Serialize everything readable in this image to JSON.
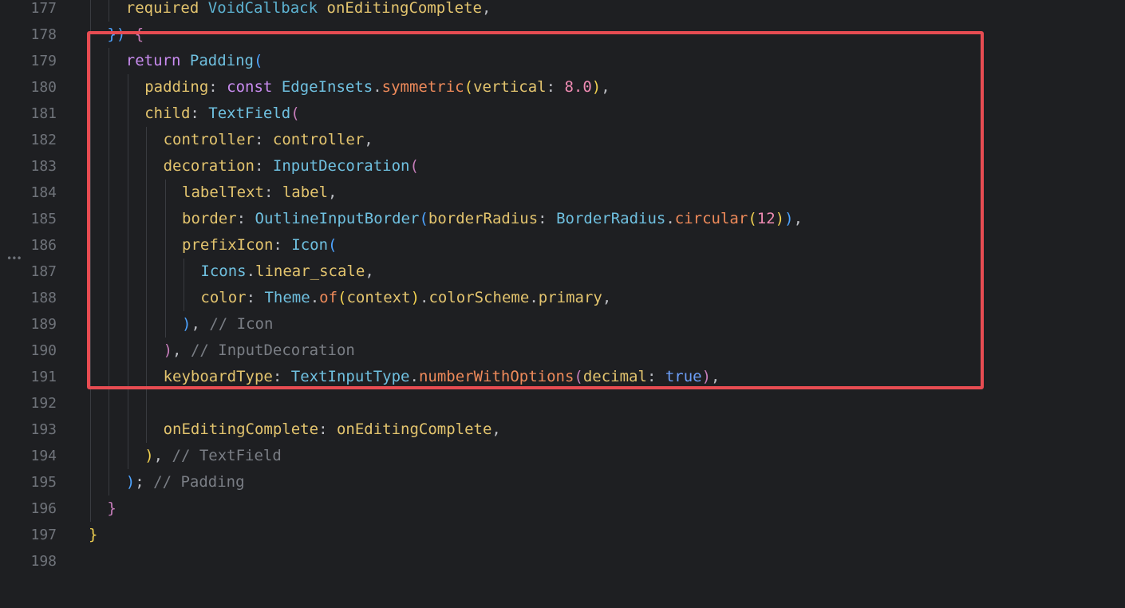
{
  "editor": {
    "lines": [
      {
        "n": "177",
        "tokens": [
          [
            "prop",
            "required"
          ],
          [
            "plain",
            " "
          ],
          [
            "cls",
            "VoidCallback"
          ],
          [
            "plain",
            " "
          ],
          [
            "prop",
            "onEditingComplete"
          ],
          [
            "plain",
            ","
          ]
        ],
        "indent": 2
      },
      {
        "n": "178",
        "tokens": [
          [
            "par3",
            "})"
          ],
          [
            "plain",
            " "
          ],
          [
            "par1",
            "{"
          ]
        ],
        "indent": 1
      },
      {
        "n": "179",
        "tokens": [
          [
            "retkw",
            "return"
          ],
          [
            "plain",
            " "
          ],
          [
            "clsb",
            "Padding"
          ],
          [
            "par3",
            "("
          ]
        ],
        "indent": 2
      },
      {
        "n": "180",
        "tokens": [
          [
            "prop",
            "padding"
          ],
          [
            "plain",
            ": "
          ],
          [
            "constkw",
            "const"
          ],
          [
            "plain",
            " "
          ],
          [
            "clsb",
            "EdgeInsets"
          ],
          [
            "plain",
            "."
          ],
          [
            "fn",
            "symmetric"
          ],
          [
            "par2",
            "("
          ],
          [
            "prop",
            "vertical"
          ],
          [
            "plain",
            ": "
          ],
          [
            "num",
            "8.0"
          ],
          [
            "par2",
            ")"
          ],
          [
            "plain",
            ","
          ]
        ],
        "indent": 3
      },
      {
        "n": "181",
        "tokens": [
          [
            "prop",
            "child"
          ],
          [
            "plain",
            ": "
          ],
          [
            "clsb",
            "TextField"
          ],
          [
            "par1",
            "("
          ]
        ],
        "indent": 3
      },
      {
        "n": "182",
        "tokens": [
          [
            "prop",
            "controller"
          ],
          [
            "plain",
            ": "
          ],
          [
            "prop",
            "controller"
          ],
          [
            "plain",
            ","
          ]
        ],
        "indent": 4
      },
      {
        "n": "183",
        "tokens": [
          [
            "prop",
            "decoration"
          ],
          [
            "plain",
            ": "
          ],
          [
            "clsb",
            "InputDecoration"
          ],
          [
            "par1",
            "("
          ]
        ],
        "indent": 4
      },
      {
        "n": "184",
        "tokens": [
          [
            "prop",
            "labelText"
          ],
          [
            "plain",
            ": "
          ],
          [
            "prop",
            "label"
          ],
          [
            "plain",
            ","
          ]
        ],
        "indent": 5
      },
      {
        "n": "185",
        "tokens": [
          [
            "prop",
            "border"
          ],
          [
            "plain",
            ": "
          ],
          [
            "clsb",
            "OutlineInputBorder"
          ],
          [
            "par3",
            "("
          ],
          [
            "prop",
            "borderRadius"
          ],
          [
            "plain",
            ": "
          ],
          [
            "clsb",
            "BorderRadius"
          ],
          [
            "plain",
            "."
          ],
          [
            "fn",
            "circular"
          ],
          [
            "par2",
            "("
          ],
          [
            "num",
            "12"
          ],
          [
            "par2",
            ")"
          ],
          [
            "par3",
            ")"
          ],
          [
            "plain",
            ","
          ]
        ],
        "indent": 5
      },
      {
        "n": "186",
        "tokens": [
          [
            "prop",
            "prefixIcon"
          ],
          [
            "plain",
            ": "
          ],
          [
            "clsb",
            "Icon"
          ],
          [
            "par3",
            "("
          ]
        ],
        "indent": 5
      },
      {
        "n": "187",
        "tokens": [
          [
            "clsb",
            "Icons"
          ],
          [
            "plain",
            "."
          ],
          [
            "prop",
            "linear_scale"
          ],
          [
            "plain",
            ","
          ]
        ],
        "indent": 6
      },
      {
        "n": "188",
        "tokens": [
          [
            "prop",
            "color"
          ],
          [
            "plain",
            ": "
          ],
          [
            "clsb",
            "Theme"
          ],
          [
            "plain",
            "."
          ],
          [
            "fn",
            "of"
          ],
          [
            "par2",
            "("
          ],
          [
            "prop",
            "context"
          ],
          [
            "par2",
            ")"
          ],
          [
            "plain",
            "."
          ],
          [
            "prop",
            "colorScheme"
          ],
          [
            "plain",
            "."
          ],
          [
            "prop",
            "primary"
          ],
          [
            "plain",
            ","
          ]
        ],
        "indent": 6
      },
      {
        "n": "189",
        "tokens": [
          [
            "par3",
            ")"
          ],
          [
            "plain",
            ", "
          ],
          [
            "cmt",
            "// Icon"
          ]
        ],
        "indent": 5
      },
      {
        "n": "190",
        "tokens": [
          [
            "par1",
            ")"
          ],
          [
            "plain",
            ", "
          ],
          [
            "cmt",
            "// InputDecoration"
          ]
        ],
        "indent": 4
      },
      {
        "n": "191",
        "tokens": [
          [
            "prop",
            "keyboardType"
          ],
          [
            "plain",
            ": "
          ],
          [
            "clsb",
            "TextInputType"
          ],
          [
            "plain",
            "."
          ],
          [
            "fn",
            "numberWithOptions"
          ],
          [
            "par1",
            "("
          ],
          [
            "prop",
            "decimal"
          ],
          [
            "plain",
            ": "
          ],
          [
            "truekw",
            "true"
          ],
          [
            "par1",
            ")"
          ],
          [
            "plain",
            ","
          ]
        ],
        "indent": 4
      },
      {
        "n": "192",
        "tokens": [],
        "indent": 0
      },
      {
        "n": "193",
        "tokens": [
          [
            "prop",
            "onEditingComplete"
          ],
          [
            "plain",
            ": "
          ],
          [
            "prop",
            "onEditingComplete"
          ],
          [
            "plain",
            ","
          ]
        ],
        "indent": 4
      },
      {
        "n": "194",
        "tokens": [
          [
            "par2",
            ")"
          ],
          [
            "plain",
            ", "
          ],
          [
            "cmt",
            "// TextField"
          ]
        ],
        "indent": 3
      },
      {
        "n": "195",
        "tokens": [
          [
            "par3",
            ")"
          ],
          [
            "plain",
            "; "
          ],
          [
            "cmt",
            "// Padding"
          ]
        ],
        "indent": 2
      },
      {
        "n": "196",
        "tokens": [
          [
            "par1",
            "}"
          ]
        ],
        "indent": 1
      },
      {
        "n": "197",
        "tokens": [
          [
            "par2",
            "}"
          ]
        ],
        "indent": 0
      },
      {
        "n": "198",
        "tokens": [],
        "indent": 0
      }
    ],
    "fold_marker": "•••",
    "highlight_color": "#e74c52",
    "background_color": "#1e1f22"
  }
}
